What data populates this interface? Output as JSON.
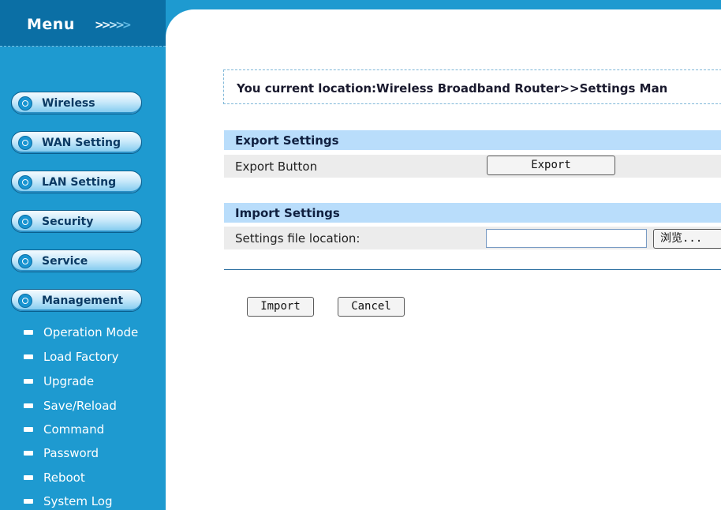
{
  "sidebar": {
    "title": "Menu",
    "arrows": ">>>>",
    "main_items": [
      {
        "label": "Wireless"
      },
      {
        "label": "WAN Setting"
      },
      {
        "label": "LAN Setting"
      },
      {
        "label": "Security"
      },
      {
        "label": "Service"
      },
      {
        "label": "Management"
      }
    ],
    "sub_items": [
      {
        "label": "Operation Mode"
      },
      {
        "label": "Load Factory"
      },
      {
        "label": "Upgrade"
      },
      {
        "label": "Save/Reload"
      },
      {
        "label": "Command"
      },
      {
        "label": "Password"
      },
      {
        "label": "Reboot"
      },
      {
        "label": "System Log"
      }
    ]
  },
  "location": {
    "text": "You current location:Wireless Broadband Router>>Settings Man"
  },
  "export_section": {
    "title": "Export Settings",
    "row_label": "Export Button",
    "button_label": "Export"
  },
  "import_section": {
    "title": "Import Settings",
    "row_label": "Settings file location:",
    "file_value": "",
    "browse_label": "浏览..."
  },
  "actions": {
    "import_label": "Import",
    "cancel_label": "Cancel"
  },
  "colors": {
    "sidebar_bg": "#1e9ad0",
    "header_bg": "#0b6fa5",
    "section_head_bg": "#b9ddfb",
    "row_bg": "#ececec"
  }
}
